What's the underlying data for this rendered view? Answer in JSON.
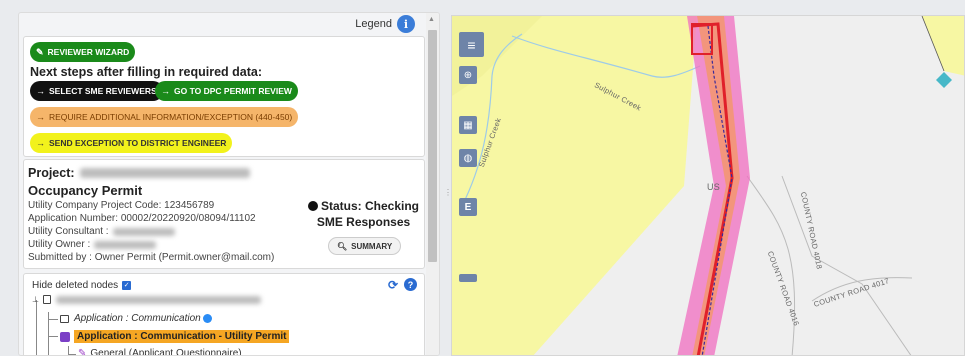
{
  "legend": {
    "label": "Legend",
    "icon": "info-icon"
  },
  "actions": {
    "wizard_label": "REVIEWER WIZARD",
    "next_steps_heading": "Next steps after filling in required data:",
    "select_sme_label": "SELECT SME REVIEWERS",
    "dpc_review_label": "GO TO DPC PERMIT REVIEW",
    "additional_info_label": "REQUIRE ADDITIONAL INFORMATION/EXCEPTION (440-450)",
    "exception_label": "SEND EXCEPTION TO DISTRICT ENGINEER",
    "colors": {
      "green": "#1a8a1a",
      "black": "#111111",
      "orange": "#f5b56a",
      "yellow": "#f2f21c"
    }
  },
  "project": {
    "project_prefix": "Project:",
    "permit_type": "Occupancy Permit",
    "utility_code": "Utility Company Project Code: 123456789",
    "application_number": "Application Number: 00002/20220920/08094/11102",
    "consultant_label": "Utility Consultant :",
    "owner_label": "Utility Owner :",
    "submitted_by": "Submitted by : Owner Permit (Permit.owner@mail.com)",
    "status_text": "Status: Checking SME Responses",
    "summary_label": "SUMMARY"
  },
  "tree": {
    "hide_deleted_label": "Hide deleted nodes",
    "nodes": [
      {
        "label": "Application : Communication"
      },
      {
        "label": "Application : Communication - Utility Permit"
      },
      {
        "label": "General (Applicant Questionnaire)"
      }
    ]
  },
  "map": {
    "labels": {
      "creek": "Sulphur Creek",
      "creek2": "Sulphur Creek",
      "road_4018": "COUNTY ROAD 4018",
      "road_4017": "COUNTY ROAD 4017",
      "road_4016": "COUNTY ROAD 4016",
      "us_label": "US"
    },
    "control_letter": "E",
    "colors": {
      "corridor": "#f06ec0",
      "route": "#e0202a",
      "land": "#f7f7a3"
    }
  }
}
